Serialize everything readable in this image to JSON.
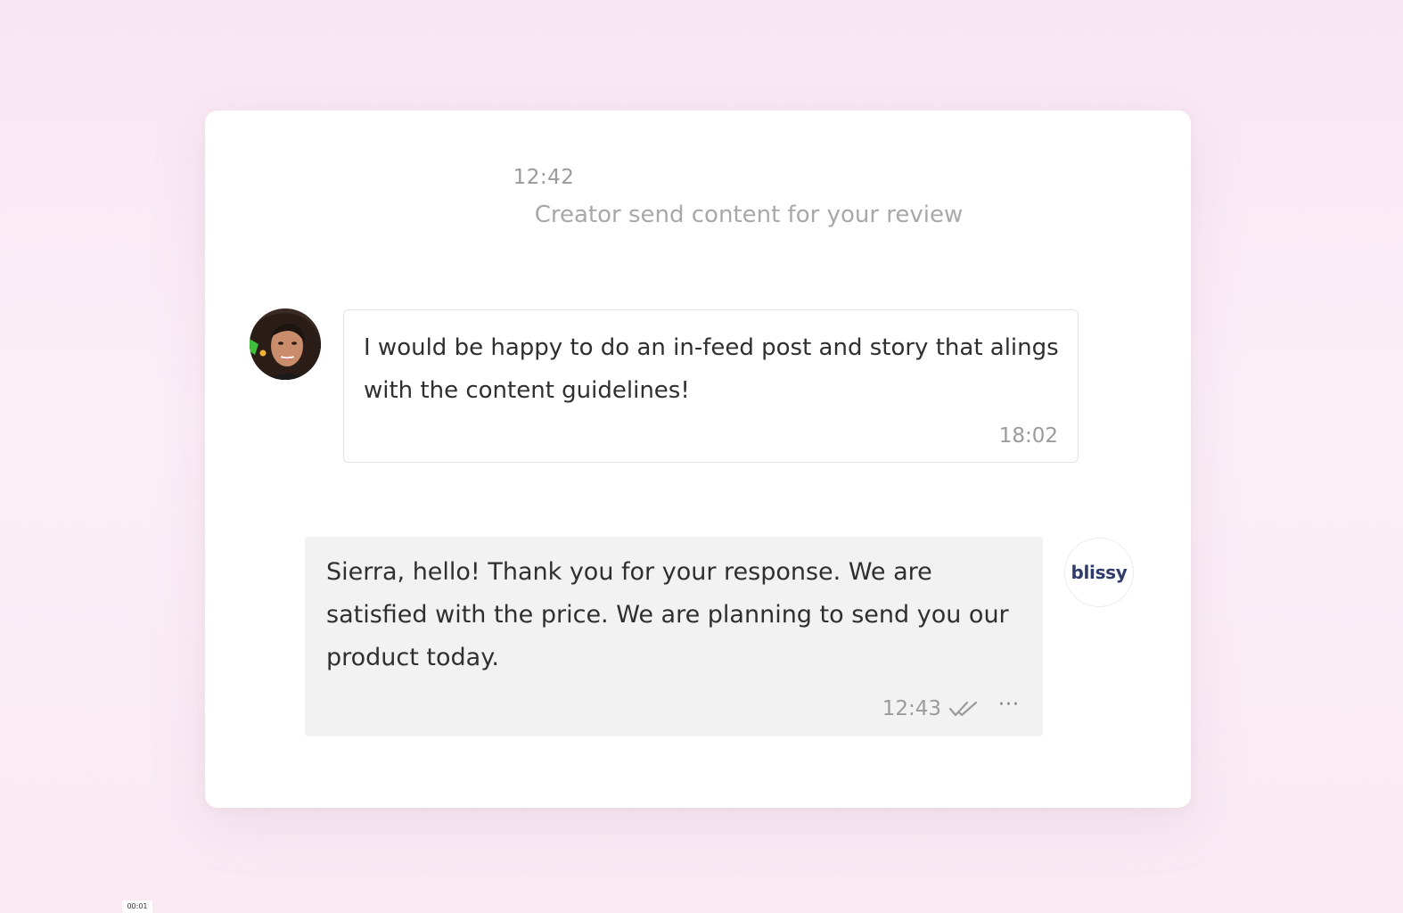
{
  "system_event": {
    "time": "12:42",
    "text": "Creator send content for your review"
  },
  "messages": [
    {
      "sender": "creator",
      "avatar_icon": "creator-photo-avatar",
      "text": "I would be happy to do an in-feed post and story that alings with the content guidelines!",
      "time": "18:02"
    },
    {
      "sender": "brand",
      "brand_logo_text": "blissy",
      "text": "Sierra, hello! Thank you for your response. We are satisfied with the price. We are planning to send you our product today.",
      "time": "12:43",
      "status_icon": "double-check-icon",
      "more_icon": "ellipsis-icon"
    }
  ],
  "video_timestamp": "00:01",
  "colors": {
    "background": "#f8e6f3",
    "card": "#ffffff",
    "outgoing_bubble": "#f2f2f2",
    "brand_text": "#2f3b6b",
    "muted_text": "#9b9b9b"
  }
}
